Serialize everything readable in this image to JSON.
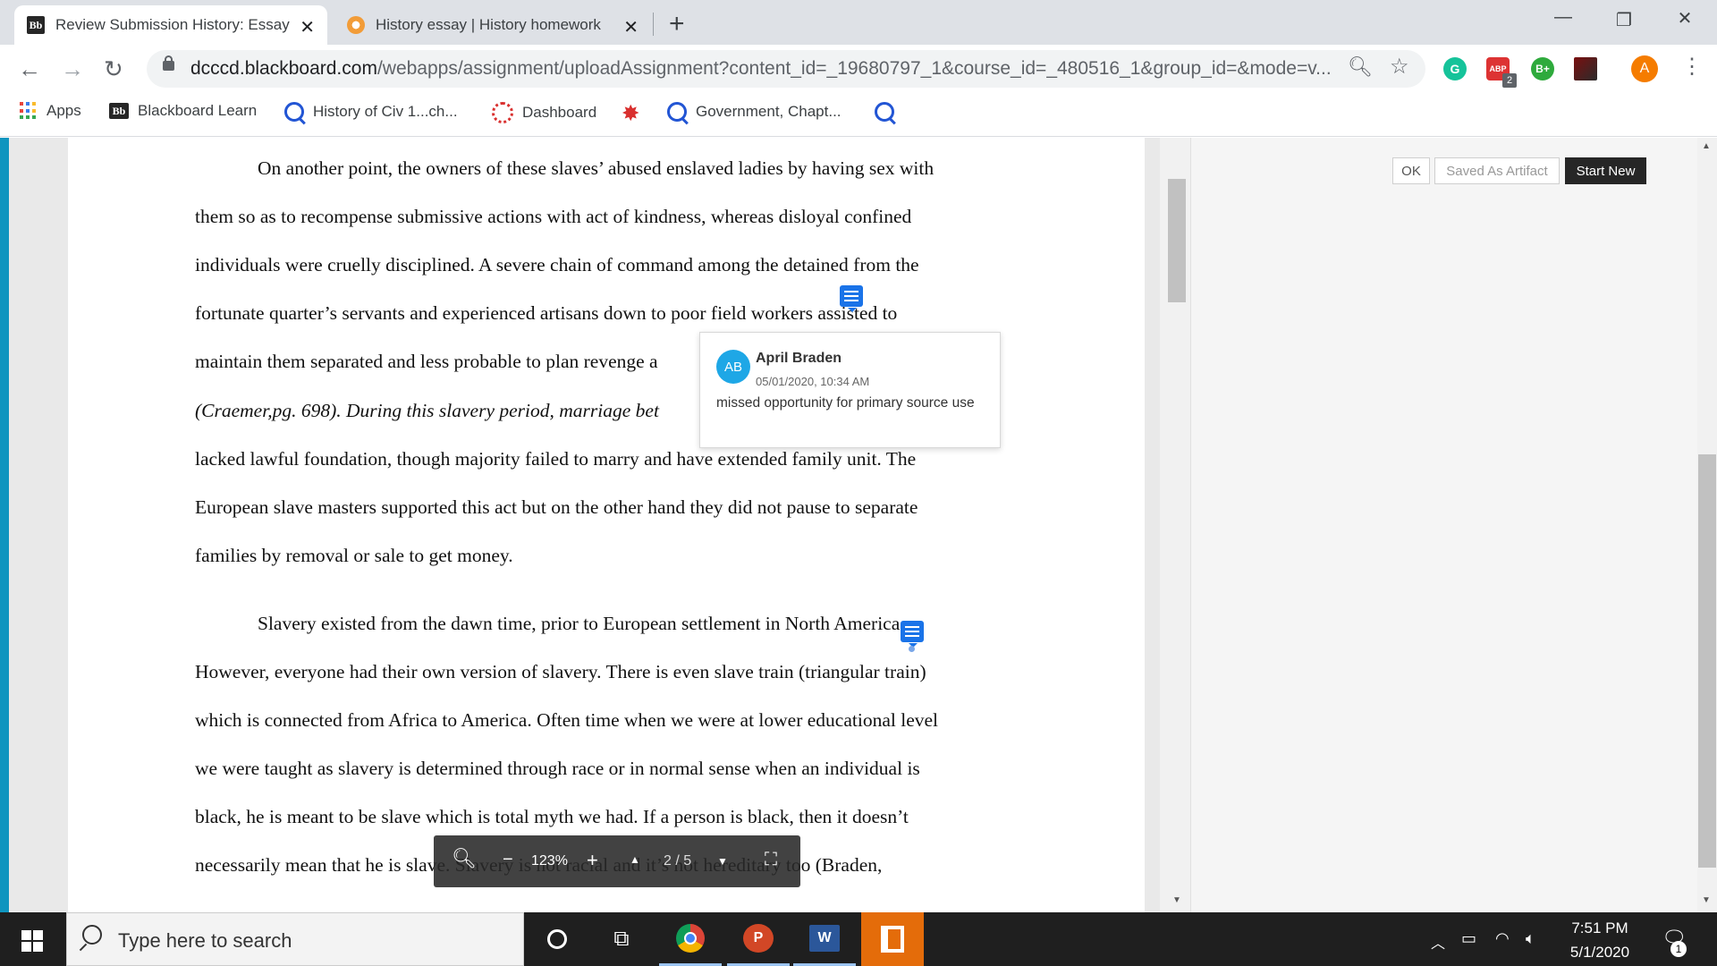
{
  "browser": {
    "tabs": [
      {
        "label": "Review Submission History: Essay",
        "active": true
      },
      {
        "label": "History essay | History homework",
        "active": false
      }
    ],
    "url_host": "dcccd.blackboard.com",
    "url_path": "/webapps/assignment/uploadAssignment?content_id=_19680797_1&course_id=_480516_1&group_id=&mode=v...",
    "profile_initial": "A",
    "extension_badge": "2",
    "extension_bplus": "B+"
  },
  "bookmarks": [
    {
      "label": "Apps"
    },
    {
      "label": "Blackboard Learn"
    },
    {
      "label": "History of Civ 1...ch..."
    },
    {
      "label": "Dashboard"
    },
    {
      "label": ""
    },
    {
      "label": "Government, Chapt..."
    },
    {
      "label": ""
    }
  ],
  "document": {
    "paragraph1": [
      "On another point, the owners of these slaves’ abused enslaved ladies by having sex with",
      "them so as to recompense submissive actions with act of kindness, whereas disloyal confined",
      "individuals were cruelly disciplined. A severe chain of command among the detained from the",
      "fortunate quarter’s servants and experienced artisans down to poor field workers assisted to",
      "maintain them separated and less probable to plan revenge a",
      "(Craemer,pg. 698). During this slavery period, marriage bet",
      "lacked lawful foundation, though majority failed to marry and have extended family unit. The",
      "European slave masters supported this act but on the other hand they did not pause to separate",
      "families by removal or sale to get money."
    ],
    "paragraph2": [
      "Slavery existed from the dawn time, prior to European settlement in North America.",
      "However, everyone had their own version of slavery. There is even slave train (triangular train)",
      "which is connected from Africa to America. Often time when we were at lower educational level",
      "we were taught as slavery is determined through race or in normal sense when an individual is",
      "black, he is meant to be slave which is total myth we had. If a person is black, then it doesn’t",
      "necessarily mean that he is slave. Slavery is not racial and it’s not hereditary too (Braden,"
    ]
  },
  "comment": {
    "initials": "AB",
    "author": "April Braden",
    "date": "05/01/2020, 10:34 AM",
    "text": "missed opportunity for primary source use"
  },
  "side_buttons": {
    "ok": "OK",
    "saved": "Saved As Artifact",
    "start_new": "Start New"
  },
  "pdf_toolbar": {
    "zoom": "123%",
    "page": "2 / 5"
  },
  "taskbar": {
    "search_placeholder": "Type here to search",
    "time": "7:51 PM",
    "date": "5/1/2020",
    "notifications": "1"
  }
}
